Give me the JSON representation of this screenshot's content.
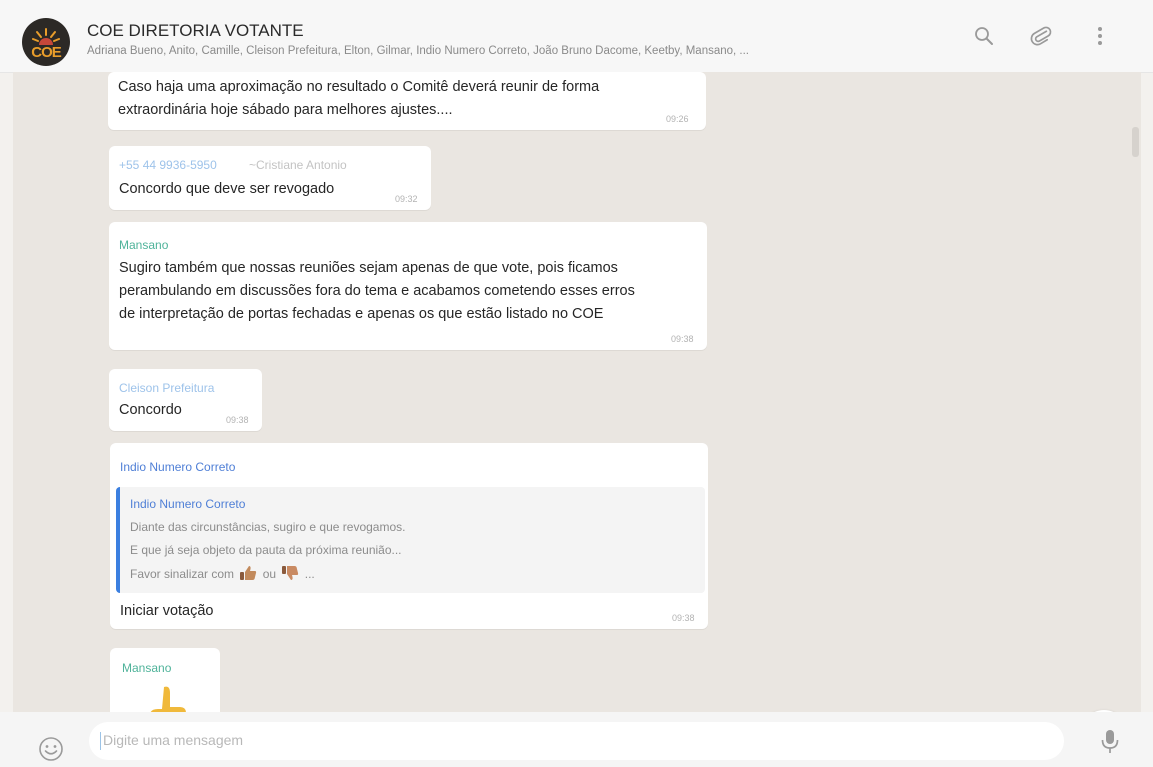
{
  "header": {
    "avatar_text": "COE",
    "title": "COE DIRETORIA VOTANTE",
    "members": "Adriana Bueno, Anito, Camille, Cleison Prefeitura, Elton, Gilmar, Indio Numero Correto, João Bruno Dacome, Keetby, Mansano, ...",
    "icons": [
      "search-icon",
      "attach-icon",
      "menu-icon"
    ]
  },
  "messages": [
    {
      "text": [
        "Caso haja uma aproximação  no resultado o Comitê deverá reunir de forma",
        "extraordinária hoje sábado para melhores ajustes...."
      ],
      "time": "09:26"
    },
    {
      "sender_phone": "+55 44 9936-5950",
      "sender_name": "~Cristiane Antonio",
      "text": "Concordo que deve ser revogado",
      "time": "09:32"
    },
    {
      "sender": "Mansano",
      "text": [
        "Sugiro também que nossas reuniões sejam apenas de que vote, pois ficamos",
        "perambulando em discussões fora do tema e acabamos cometendo esses erros",
        "de interpretação de portas fechadas e apenas os que estão listado no COE"
      ],
      "time": "09:38"
    },
    {
      "sender": "Cleison Prefeitura",
      "text": "Concordo",
      "time": "09:38"
    },
    {
      "sender": "Indio Numero Correto",
      "quote": {
        "author": "Indio Numero Correto",
        "lines": [
          "Diante das circunstâncias, sugiro e que revogamos.",
          "E que já seja objeto da pauta da próxima reunião..."
        ],
        "last_prefix": "Favor sinalizar  com",
        "last_mid": "ou",
        "last_suffix": "..."
      },
      "text": "Iniciar votação",
      "time": "09:38"
    },
    {
      "sender": "Mansano"
    }
  ],
  "composer": {
    "placeholder": "Digite uma mensagem",
    "icons": [
      "emoji-icon",
      "microphone-icon"
    ]
  },
  "colors": {
    "chat_background": "#eae6e1",
    "bubble": "#ffffff",
    "sender_green": "#4fb39a",
    "sender_blue": "#4f7fd6",
    "sender_lightblue": "#9ec3ea",
    "quote_bar": "#3b7fe0",
    "thumb": "#f0b93b"
  }
}
